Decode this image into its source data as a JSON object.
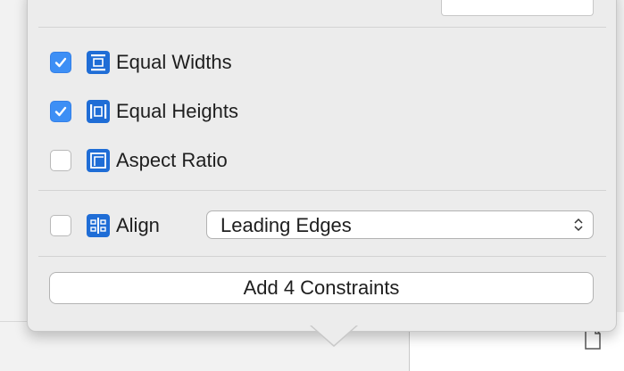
{
  "constraints": {
    "equal_widths": {
      "label": "Equal Widths",
      "checked": true
    },
    "equal_heights": {
      "label": "Equal Heights",
      "checked": true
    },
    "aspect_ratio": {
      "label": "Aspect Ratio",
      "checked": false
    }
  },
  "align": {
    "label": "Align",
    "checked": false,
    "selected": "Leading Edges"
  },
  "add_button": {
    "label": "Add 4 Constraints"
  },
  "colors": {
    "accent": "#3d8ff5",
    "icon_blue": "#1f6dd6",
    "popover_bg": "#ececec"
  },
  "icons": [
    "checkmark-icon",
    "equal-widths-icon",
    "equal-heights-icon",
    "aspect-ratio-icon",
    "align-icon",
    "stepper-icon",
    "document-icon"
  ]
}
